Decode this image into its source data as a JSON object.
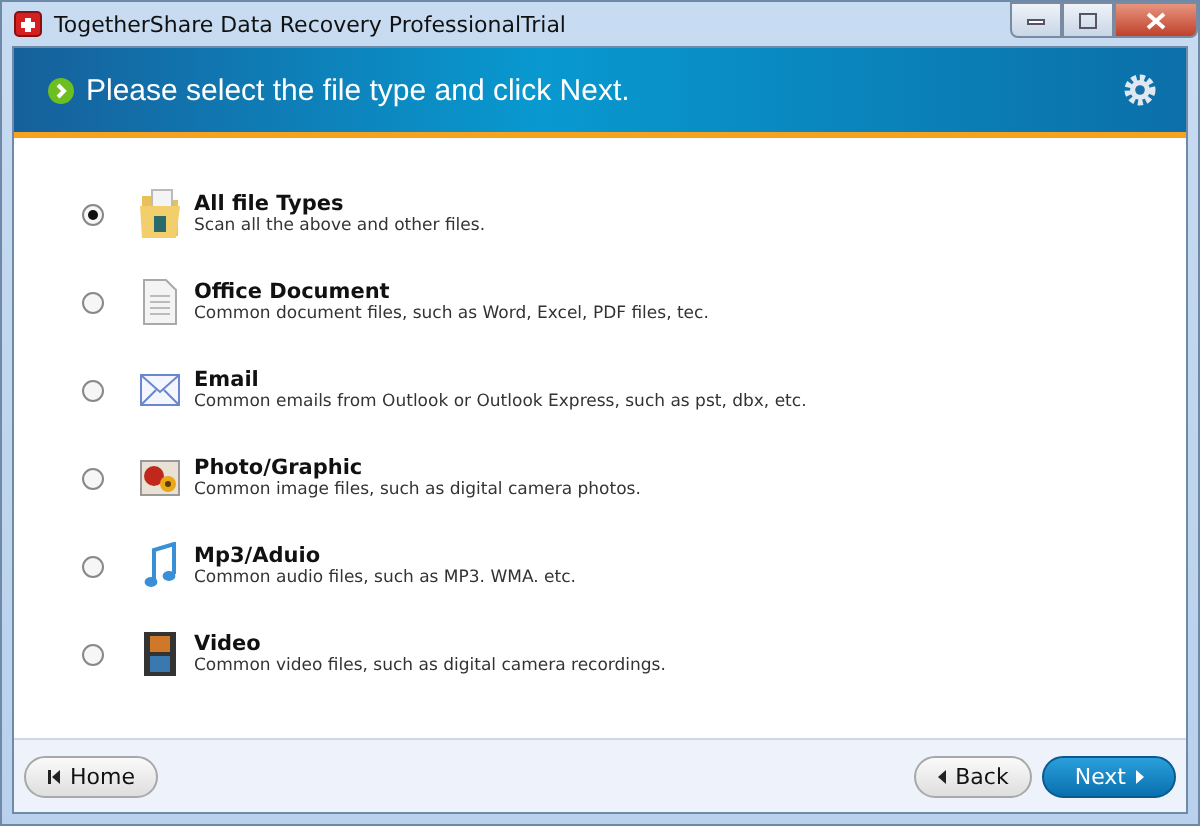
{
  "window": {
    "title": "TogetherShare Data Recovery ProfessionalTrial"
  },
  "header": {
    "text": "Please select the file type and click Next."
  },
  "options": [
    {
      "kind": "all",
      "title": "All file Types",
      "description": "Scan all the above and other files.",
      "selected": true
    },
    {
      "kind": "document",
      "title": "Office Document",
      "description": "Common document files, such as Word, Excel, PDF files, tec.",
      "selected": false
    },
    {
      "kind": "email",
      "title": "Email",
      "description": "Common emails from Outlook or Outlook Express, such as pst, dbx, etc.",
      "selected": false
    },
    {
      "kind": "photo",
      "title": "Photo/Graphic",
      "description": "Common image files, such as digital camera photos.",
      "selected": false
    },
    {
      "kind": "audio",
      "title": "Mp3/Aduio",
      "description": "Common audio files, such as MP3. WMA. etc.",
      "selected": false
    },
    {
      "kind": "video",
      "title": "Video",
      "description": "Common video files, such as digital camera recordings.",
      "selected": false
    }
  ],
  "footer": {
    "home": "Home",
    "back": "Back",
    "next": "Next"
  }
}
